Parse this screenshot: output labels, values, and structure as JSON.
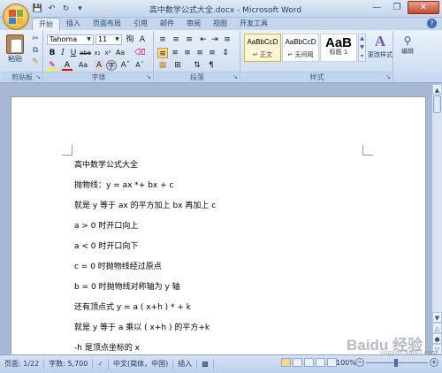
{
  "window": {
    "title": "高中数学公式大全.docx - Microsoft Word"
  },
  "qat": {
    "save_icon": "save-icon",
    "undo_icon": "undo-icon",
    "redo_icon": "redo-icon",
    "customize_icon": "dropdown-icon"
  },
  "tabs": [
    {
      "label": "开始",
      "active": true
    },
    {
      "label": "插入"
    },
    {
      "label": "页面布局"
    },
    {
      "label": "引用"
    },
    {
      "label": "邮件"
    },
    {
      "label": "审阅"
    },
    {
      "label": "视图"
    },
    {
      "label": "开发工具"
    }
  ],
  "ribbon": {
    "clipboard": {
      "paste_label": "粘贴",
      "group_label": "剪贴板"
    },
    "font": {
      "font_name": "Tahoma",
      "font_size": "11",
      "group_label": "字体"
    },
    "paragraph": {
      "group_label": "段落"
    },
    "styles": {
      "group_label": "样式",
      "items": [
        {
          "sample": "AaBbCcD",
          "name": "↵ 正文"
        },
        {
          "sample": "AaBbCcD",
          "name": "↵ 无间隔"
        },
        {
          "sample": "AaB",
          "name": "标题 1"
        }
      ],
      "change_styles": "更改样式"
    },
    "editing": {
      "label": "编辑"
    }
  },
  "document": {
    "lines": [
      "高中数学公式大全",
      "抛物线：y = ax *+ bx + c",
      "就是 y 等于 ax 的平方加上 bx 再加上 c",
      "a > 0 时开口向上",
      "a < 0 时开口向下",
      "c = 0 时抛物线经过原点",
      "b = 0 时抛物线对称轴为 y 轴",
      "还有顶点式 y = a ( x+h ) * + k",
      "就是 y 等于 a 乘以 ( x+h ) 的平方+k",
      "-h 是顶点坐标的 x"
    ]
  },
  "status": {
    "page": "页面: 1/22",
    "words": "字数: 5,700",
    "language": "中文(简体，中国)",
    "mode": "插入",
    "zoom": "100%"
  },
  "watermark": {
    "text": "Baidu 经验",
    "sub": "jingyan.baidu.com"
  }
}
